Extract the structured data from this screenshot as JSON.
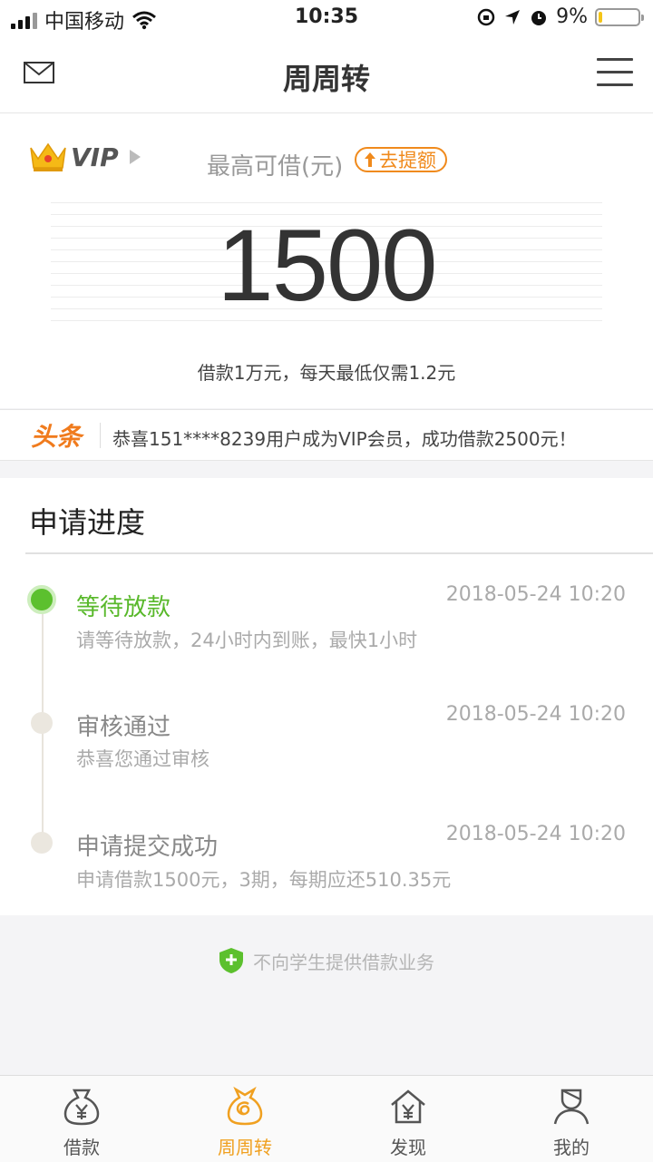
{
  "status_bar": {
    "carrier": "中国移动",
    "time": "10:35",
    "battery": "9%",
    "battery_level": 0.09
  },
  "navbar": {
    "title": "周周转"
  },
  "vip": {
    "label": "VIP"
  },
  "limit": {
    "label": "最高可借(元)",
    "raise_button": "去提额",
    "amount": "1500",
    "note": "借款1万元，每天最低仅需1.2元"
  },
  "news": {
    "logo": "头条",
    "text": "恭喜151****8239用户成为VIP会员，成功借款2500元！"
  },
  "progress": {
    "title": "申请进度",
    "steps": [
      {
        "title": "等待放款",
        "desc": "请等待放款，24小时内到账，最快1小时",
        "time": "2018-05-24 10:20"
      },
      {
        "title": "审核通过",
        "desc": "恭喜您通过审核",
        "time": "2018-05-24 10:20"
      },
      {
        "title": "申请提交成功",
        "desc": "申请借款1500元，3期，每期应还510.35元",
        "time": "2018-05-24 10:20"
      }
    ]
  },
  "notice": {
    "text": "不向学生提供借款业务"
  },
  "tabs": [
    {
      "label": "借款",
      "icon": "money-bag-icon"
    },
    {
      "label": "周周转",
      "icon": "spiral-bag-icon"
    },
    {
      "label": "发现",
      "icon": "house-yen-icon"
    },
    {
      "label": "我的",
      "icon": "person-icon"
    }
  ],
  "colors": {
    "accent": "#f0a020",
    "orange": "#f08a1c",
    "green": "#5cc02e"
  }
}
